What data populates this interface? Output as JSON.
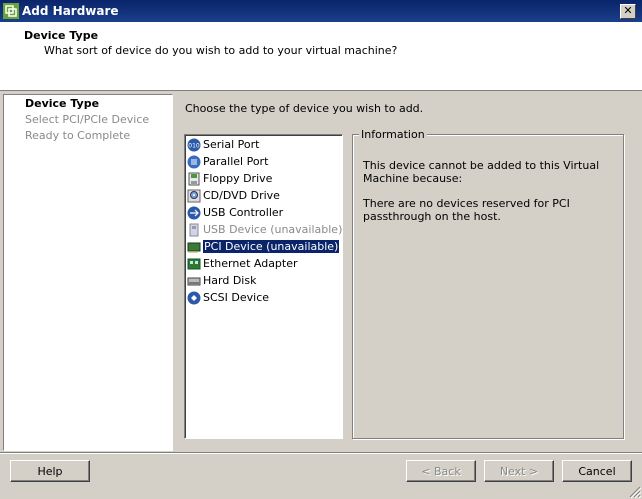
{
  "window": {
    "title": "Add Hardware",
    "close_glyph": "✕"
  },
  "header": {
    "title": "Device Type",
    "subtitle": "What sort of device do you wish to add to your virtual machine?"
  },
  "nav": {
    "items": [
      {
        "label": "Device Type",
        "active": true
      },
      {
        "label": "Select PCI/PCIe Device",
        "active": false
      },
      {
        "label": "Ready to Complete",
        "active": false
      }
    ]
  },
  "main": {
    "instructions": "Choose the type of device you wish to add.",
    "devices": [
      {
        "label": "Serial Port",
        "icon": "serial-port-icon",
        "disabled": false,
        "selected": false
      },
      {
        "label": "Parallel Port",
        "icon": "parallel-port-icon",
        "disabled": false,
        "selected": false
      },
      {
        "label": "Floppy Drive",
        "icon": "floppy-drive-icon",
        "disabled": false,
        "selected": false
      },
      {
        "label": "CD/DVD Drive",
        "icon": "cd-dvd-drive-icon",
        "disabled": false,
        "selected": false
      },
      {
        "label": "USB Controller",
        "icon": "usb-controller-icon",
        "disabled": false,
        "selected": false
      },
      {
        "label": "USB Device (unavailable)",
        "icon": "usb-device-icon",
        "disabled": true,
        "selected": false
      },
      {
        "label": "PCI Device (unavailable)",
        "icon": "pci-device-icon",
        "disabled": false,
        "selected": true
      },
      {
        "label": "Ethernet Adapter",
        "icon": "ethernet-adapter-icon",
        "disabled": false,
        "selected": false
      },
      {
        "label": "Hard Disk",
        "icon": "hard-disk-icon",
        "disabled": false,
        "selected": false
      },
      {
        "label": "SCSI Device",
        "icon": "scsi-device-icon",
        "disabled": false,
        "selected": false
      }
    ],
    "info": {
      "legend": "Information",
      "line1": "This device cannot be added to this Virtual Machine because:",
      "line2": "There are no devices reserved for PCI passthrough on the host."
    }
  },
  "buttons": {
    "help": "Help",
    "back": "< Back",
    "next": "Next >",
    "cancel": "Cancel"
  },
  "colors": {
    "title_bar": "#0a246a",
    "selection": "#0a246a",
    "face": "#d4d0c8",
    "disabled_text": "#8a8a8a"
  }
}
